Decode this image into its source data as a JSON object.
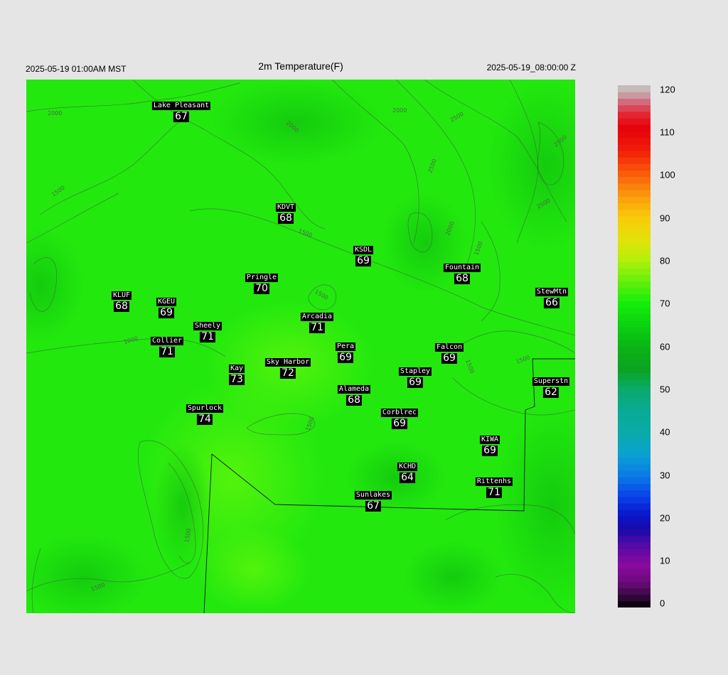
{
  "header": {
    "local_time": "2025-05-19 01:00AM MST",
    "title": "2m Temperature(F)",
    "utc_time": "2025-05-19_08:00:00 Z"
  },
  "map": {
    "stations": [
      {
        "name": "Lake Pleasant",
        "value": "67"
      },
      {
        "name": "KDVT",
        "value": "68"
      },
      {
        "name": "KSDL",
        "value": "69"
      },
      {
        "name": "Fountain",
        "value": "68"
      },
      {
        "name": "Pringle",
        "value": "70"
      },
      {
        "name": "StewMtn",
        "value": "66"
      },
      {
        "name": "KLUF",
        "value": "68"
      },
      {
        "name": "KGEU",
        "value": "69"
      },
      {
        "name": "Arcadia",
        "value": "71"
      },
      {
        "name": "Sheely",
        "value": "71"
      },
      {
        "name": "Collier",
        "value": "71"
      },
      {
        "name": "Pera",
        "value": "69"
      },
      {
        "name": "Falcon",
        "value": "69"
      },
      {
        "name": "Kay",
        "value": "73"
      },
      {
        "name": "Sky Harbor",
        "value": "72"
      },
      {
        "name": "Stapley",
        "value": "69"
      },
      {
        "name": "Superstn",
        "value": "62"
      },
      {
        "name": "Alameda",
        "value": "68"
      },
      {
        "name": "Spurlock",
        "value": "74"
      },
      {
        "name": "Corblrec",
        "value": "69"
      },
      {
        "name": "KIWA",
        "value": "69"
      },
      {
        "name": "KCHD",
        "value": "64"
      },
      {
        "name": "Rittenhs",
        "value": "71"
      },
      {
        "name": "Sunlakes",
        "value": "67"
      }
    ],
    "contour_labels": [
      "2000",
      "2000",
      "2000",
      "2500",
      "2500",
      "2500",
      "2500",
      "2000",
      "1500",
      "1500",
      "1500",
      "1500",
      "1000",
      "1500",
      "1500",
      "1500",
      "1500",
      "1500"
    ],
    "base_color": "#22e80e",
    "warm_color": "#5cf50c",
    "cool_color": "#12c80e"
  },
  "colorbar": {
    "min": 0,
    "max": 120,
    "tick_labels": [
      "120",
      "110",
      "100",
      "90",
      "80",
      "70",
      "60",
      "50",
      "40",
      "30",
      "20",
      "10",
      "0"
    ],
    "stops": [
      {
        "v": 0,
        "c": "#000000"
      },
      {
        "v": 3,
        "c": "#3a0a45"
      },
      {
        "v": 6,
        "c": "#6e0a7e"
      },
      {
        "v": 10,
        "c": "#8a0aa0"
      },
      {
        "v": 15,
        "c": "#4a0aa8"
      },
      {
        "v": 18,
        "c": "#1a0aa8"
      },
      {
        "v": 21,
        "c": "#0a14c8"
      },
      {
        "v": 25,
        "c": "#0a3ae6"
      },
      {
        "v": 30,
        "c": "#0a78e6"
      },
      {
        "v": 35,
        "c": "#0aa0d2"
      },
      {
        "v": 40,
        "c": "#0aaaaa"
      },
      {
        "v": 45,
        "c": "#0aaa96"
      },
      {
        "v": 50,
        "c": "#0aaa6e"
      },
      {
        "v": 55,
        "c": "#0aa41e"
      },
      {
        "v": 60,
        "c": "#0ab414"
      },
      {
        "v": 65,
        "c": "#0ad20f"
      },
      {
        "v": 70,
        "c": "#14ee0a"
      },
      {
        "v": 75,
        "c": "#64f00a"
      },
      {
        "v": 80,
        "c": "#b4f00a"
      },
      {
        "v": 85,
        "c": "#e6e00a"
      },
      {
        "v": 90,
        "c": "#fac80a"
      },
      {
        "v": 95,
        "c": "#fa960a"
      },
      {
        "v": 100,
        "c": "#fa5a0a"
      },
      {
        "v": 105,
        "c": "#f01e0a"
      },
      {
        "v": 110,
        "c": "#e6000a"
      },
      {
        "v": 113,
        "c": "#e61e28"
      },
      {
        "v": 116,
        "c": "#d26478"
      },
      {
        "v": 118,
        "c": "#c8a0a8"
      },
      {
        "v": 120,
        "c": "#c8c8c8"
      }
    ]
  }
}
